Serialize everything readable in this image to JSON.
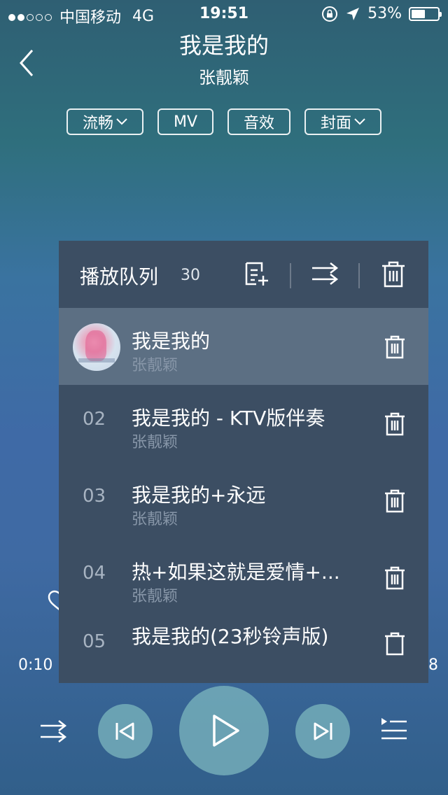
{
  "status_bar": {
    "carrier": "中国移动",
    "network": "4G",
    "time": "19:51",
    "battery": "53%",
    "battery_level": 0.53
  },
  "header": {
    "title": "我是我的",
    "artist": "张靓颖"
  },
  "chips": [
    {
      "label": "流畅",
      "has_dropdown": true
    },
    {
      "label": "MV",
      "has_dropdown": false
    },
    {
      "label": "音效",
      "has_dropdown": false
    },
    {
      "label": "封面",
      "has_dropdown": true
    }
  ],
  "queue": {
    "title": "播放队列",
    "count": "30",
    "items": [
      {
        "number": "",
        "title": "我是我的",
        "artist": "张靓颖",
        "playing": true
      },
      {
        "number": "02",
        "title": "我是我的 - KTV版伴奏",
        "artist": "张靓颖"
      },
      {
        "number": "03",
        "title": "我是我的+永远",
        "artist": "张靓颖"
      },
      {
        "number": "04",
        "title": "热+如果这就是爱情+...",
        "artist": "张靓颖"
      },
      {
        "number": "05",
        "title": "我是我的(23秒铃声版)",
        "artist": ""
      }
    ]
  },
  "player": {
    "current_time": "0:10",
    "end_time_visible": "8"
  },
  "colors": {
    "panel": "#3c4e63",
    "active_row": "#5c6f83",
    "control_circle": "#78b2bc"
  }
}
